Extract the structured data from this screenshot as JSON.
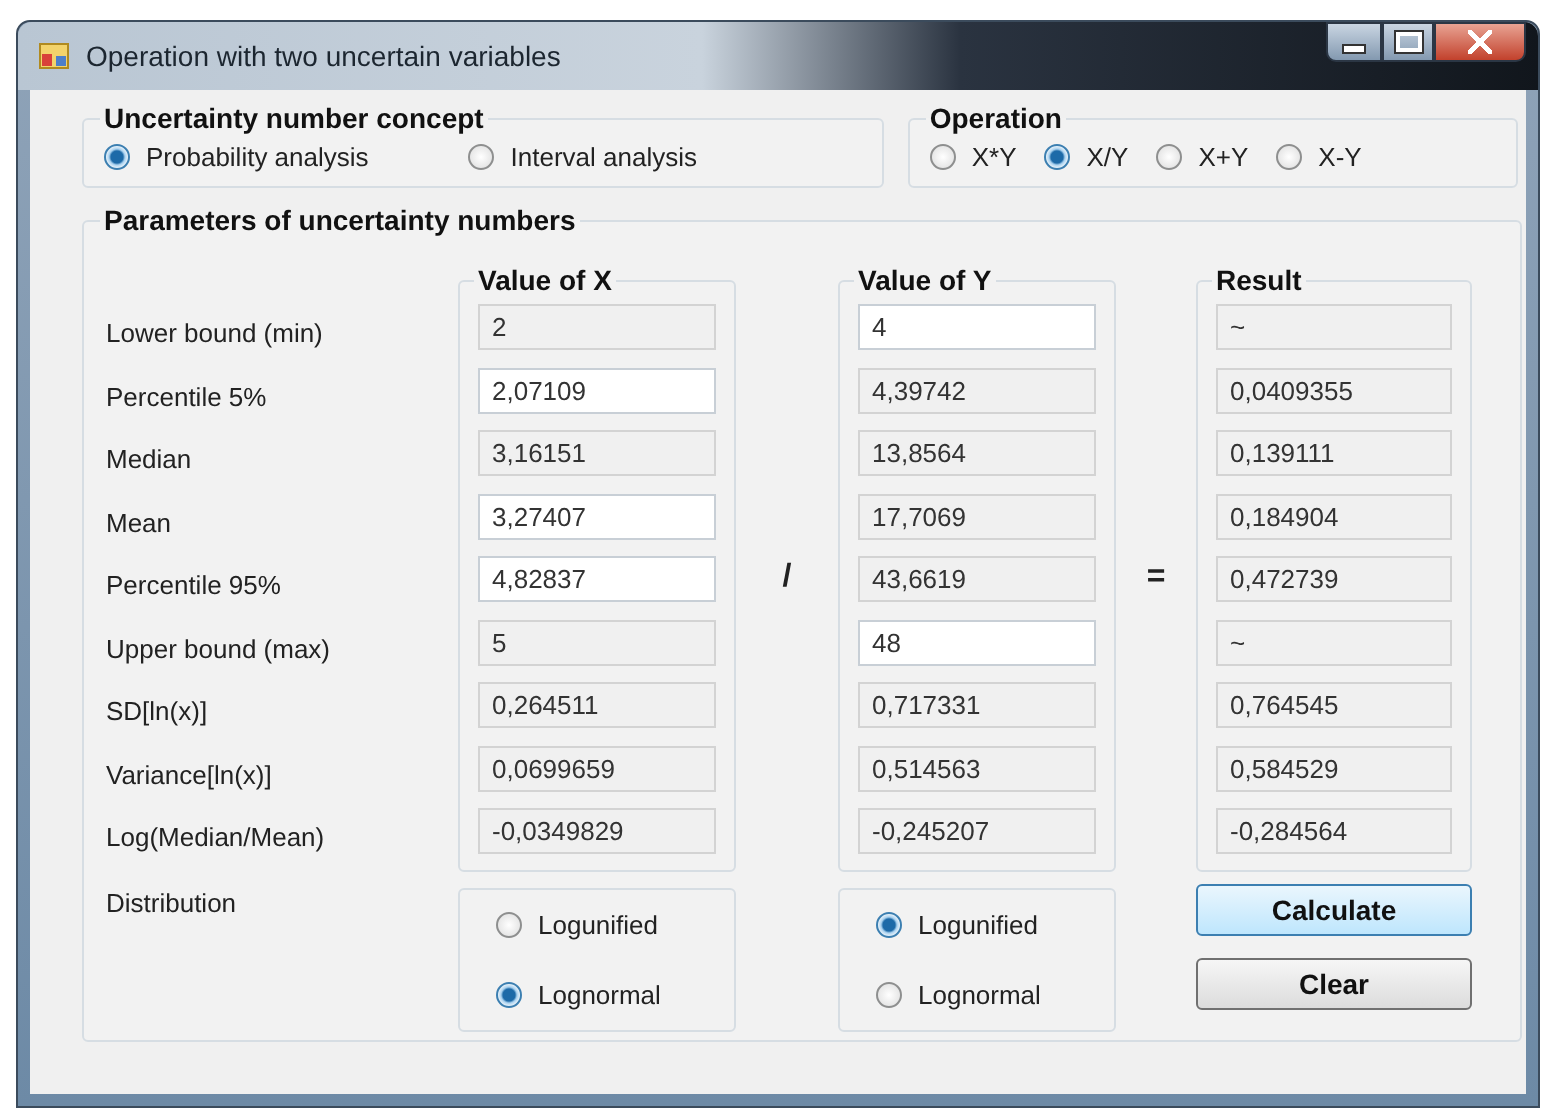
{
  "window": {
    "title": "Operation with two uncertain variables"
  },
  "concept": {
    "title": "Uncertainty number concept",
    "options": [
      {
        "label": "Probability analysis",
        "selected": true
      },
      {
        "label": "Interval analysis",
        "selected": false
      }
    ]
  },
  "operation": {
    "title": "Operation",
    "options": [
      {
        "label": "X*Y",
        "selected": false
      },
      {
        "label": "X/Y",
        "selected": true
      },
      {
        "label": "X+Y",
        "selected": false
      },
      {
        "label": "X-Y",
        "selected": false
      }
    ]
  },
  "parameters": {
    "title": "Parameters of uncertainty numbers",
    "row_labels": [
      "Lower bound (min)",
      "Percentile 5%",
      "Median",
      "Mean",
      "Percentile 95%",
      "Upper bound (max)",
      "SD[ln(x)]",
      "Variance[ln(x)]",
      "Log(Median/Mean)"
    ],
    "columns": [
      {
        "title": "Value of X",
        "cells": [
          {
            "value": "2",
            "editable": false
          },
          {
            "value": "2,07109",
            "editable": true
          },
          {
            "value": "3,16151",
            "editable": false
          },
          {
            "value": "3,27407",
            "editable": true
          },
          {
            "value": "4,82837",
            "editable": true
          },
          {
            "value": "5",
            "editable": false
          },
          {
            "value": "0,264511",
            "editable": false
          },
          {
            "value": "0,0699659",
            "editable": false
          },
          {
            "value": "-0,0349829",
            "editable": false
          }
        ]
      },
      {
        "title": "Value of Y",
        "cells": [
          {
            "value": "4",
            "editable": true
          },
          {
            "value": "4,39742",
            "editable": false
          },
          {
            "value": "13,8564",
            "editable": false
          },
          {
            "value": "17,7069",
            "editable": false
          },
          {
            "value": "43,6619",
            "editable": false
          },
          {
            "value": "48",
            "editable": true
          },
          {
            "value": "0,717331",
            "editable": false
          },
          {
            "value": "0,514563",
            "editable": false
          },
          {
            "value": "-0,245207",
            "editable": false
          }
        ]
      },
      {
        "title": "Result",
        "cells": [
          {
            "value": "~",
            "editable": false
          },
          {
            "value": "0,0409355",
            "editable": false
          },
          {
            "value": "0,139111",
            "editable": false
          },
          {
            "value": "0,184904",
            "editable": false
          },
          {
            "value": "0,472739",
            "editable": false
          },
          {
            "value": "~",
            "editable": false
          },
          {
            "value": "0,764545",
            "editable": false
          },
          {
            "value": "0,584529",
            "editable": false
          },
          {
            "value": "-0,284564",
            "editable": false
          }
        ]
      }
    ],
    "operators": [
      "/",
      "="
    ],
    "distribution_label": "Distribution",
    "distributions": [
      {
        "options": [
          {
            "label": "Logunified",
            "selected": false
          },
          {
            "label": "Lognormal",
            "selected": true
          }
        ]
      },
      {
        "options": [
          {
            "label": "Logunified",
            "selected": true
          },
          {
            "label": "Lognormal",
            "selected": false
          }
        ]
      }
    ]
  },
  "buttons": [
    {
      "label": "Calculate",
      "default": true
    },
    {
      "label": "Clear",
      "default": false
    }
  ]
}
